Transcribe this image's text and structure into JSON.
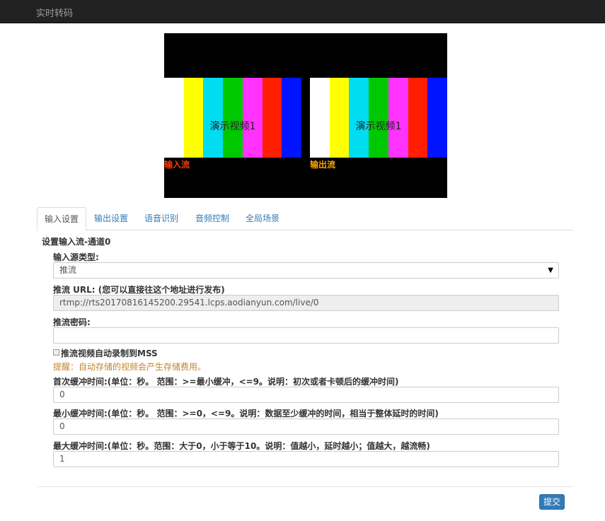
{
  "app": {
    "title": "实时转码"
  },
  "preview": {
    "caption": "演示视频1",
    "input_label": "输入流",
    "output_label": "输出流",
    "input_label_color": "#ff3b00",
    "output_label_color": "#ffa500",
    "bar_colors": [
      "#ffffff",
      "#ffff00",
      "#00dcf0",
      "#00c800",
      "#ff32ff",
      "#ff1e00",
      "#0014ff"
    ]
  },
  "tabs": [
    {
      "label": "输入设置",
      "active": true
    },
    {
      "label": "输出设置",
      "active": false
    },
    {
      "label": "语音识别",
      "active": false
    },
    {
      "label": "音频控制",
      "active": false
    },
    {
      "label": "全局场景",
      "active": false
    }
  ],
  "form": {
    "section_title": "设置输入流-通道0",
    "source_type_label": "输入源类型:",
    "source_type_value": "推流",
    "push_url_label": "推流 URL: (您可以直接往这个地址进行发布)",
    "push_url_value": "rtmp://rts20170816145200.29541.lcps.aodianyun.com/live/0",
    "push_password_label": "推流密码:",
    "push_password_value": "",
    "auto_record_label": "推流视频自动录制到MSS",
    "auto_record_note": "提醒：自动存储的视频会产生存储费用。",
    "first_buffer_label": "首次缓冲时间:(单位：秒。 范围：>=最小缓冲，<=9。说明：初次或者卡顿后的缓冲时间)",
    "first_buffer_value": "0",
    "min_buffer_label": "最小缓冲时间:(单位：秒。 范围：>=0，<=9。说明：数据至少缓冲的时间，相当于整体延时的时间)",
    "min_buffer_value": "0",
    "max_buffer_label": "最大缓冲时间:(单位：秒。范围：大于0，小于等于10。说明：值越小，延时越小；值越大，越流畅)",
    "max_buffer_value": "1",
    "submit_label": "提交"
  }
}
